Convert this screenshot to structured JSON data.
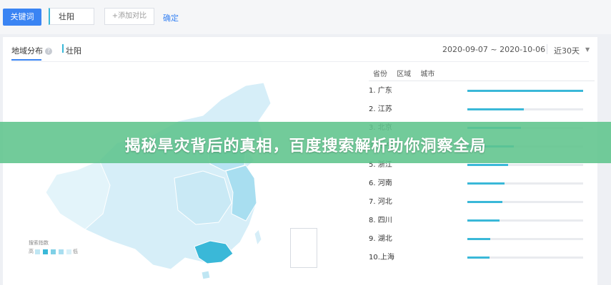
{
  "toolbar": {
    "keyword_tab": "关键词",
    "keyword_value": "壮阳",
    "add_compare": "+添加对比",
    "confirm": "确定"
  },
  "card": {
    "tab_region": "地域分布",
    "help_icon": "help-circle-icon",
    "legend_term": "壮阳",
    "date_range": "2020-09-07 ~ 2020-10-06",
    "period": "近30天",
    "caret_icon": "caret-down-icon"
  },
  "map_scale": {
    "title": "搜索指数",
    "high": "高",
    "low": "低",
    "colors": [
      "#bfe6f3",
      "#3ab8d8",
      "#7fd0e6",
      "#a8def0",
      "#d8f0f8"
    ]
  },
  "table": {
    "headers": [
      "省份",
      "区域",
      "城市"
    ],
    "rows": [
      {
        "label": "1. 广东",
        "value": 1.0
      },
      {
        "label": "2. 江苏",
        "value": 0.49
      },
      {
        "label": "3. 北京",
        "value": 0.46
      },
      {
        "label": "4. 山东",
        "value": 0.4
      },
      {
        "label": "5. 浙江",
        "value": 0.35
      },
      {
        "label": "6. 河南",
        "value": 0.32
      },
      {
        "label": "7. 河北",
        "value": 0.3
      },
      {
        "label": "8. 四川",
        "value": 0.28
      },
      {
        "label": "9. 湖北",
        "value": 0.2
      },
      {
        "label": "10.上海",
        "value": 0.19
      }
    ]
  },
  "banner": {
    "title": "揭秘旱灾背后的真相，百度搜索解析助你洞察全局"
  },
  "colors": {
    "accent": "#3a84f3",
    "bar": "#3ab8d8",
    "banner": "#5fc48c",
    "map_base": "#d6eef8",
    "map_highlight": "#3ab8d8"
  }
}
